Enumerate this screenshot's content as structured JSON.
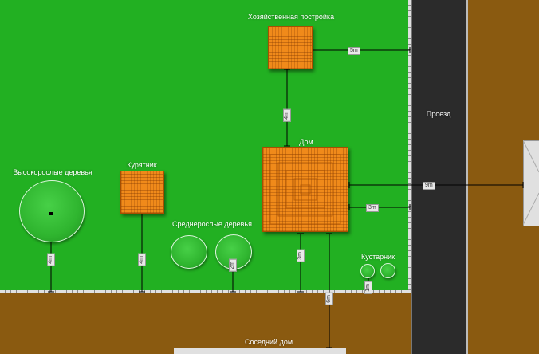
{
  "colors": {
    "lawn": "#22b022",
    "road": "#2b2b2b",
    "ground": "#8a5a10",
    "roof": "#f08a1a",
    "fence": "#d8d8d8"
  },
  "labels": {
    "outbuilding": "Хозяйственная постройка",
    "house": "Дом",
    "chicken_coop": "Курятник",
    "tall_trees": "Высокорослые деревья",
    "medium_trees": "Среднерослые деревья",
    "shrubs": "Кустарник",
    "driveway": "Проезд",
    "neighbor_house": "Соседний дом"
  },
  "dimensions": {
    "outbuilding_to_road": "5m",
    "outbuilding_to_house": "4m",
    "house_to_road": "3m",
    "house_to_neighbor_building": "9m",
    "tall_tree_to_fence": "4m",
    "coop_to_fence": "4m",
    "medium_tree_to_fence": "2m",
    "house_to_fence": "3m",
    "house_to_neighbor_house": "6m",
    "shrub_to_fence": "1m"
  }
}
